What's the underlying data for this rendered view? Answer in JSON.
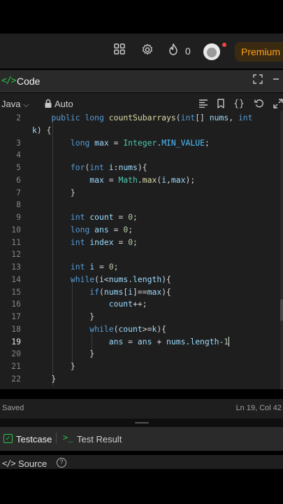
{
  "header": {
    "count": "0",
    "premium_label": "Premium"
  },
  "panel": {
    "title": "Code"
  },
  "toolbar": {
    "language": "Java",
    "mode": "Auto"
  },
  "editor": {
    "active_line": 19,
    "lines": [
      {
        "n": "2",
        "text": "    public long countSubarrays(int[] nums, int"
      },
      {
        "n": "",
        "text": "k) {"
      },
      {
        "n": "3",
        "text": "        long max = Integer.MIN_VALUE;"
      },
      {
        "n": "4",
        "text": ""
      },
      {
        "n": "5",
        "text": "        for(int i:nums){"
      },
      {
        "n": "6",
        "text": "            max = Math.max(i,max);"
      },
      {
        "n": "7",
        "text": "        }"
      },
      {
        "n": "8",
        "text": ""
      },
      {
        "n": "9",
        "text": "        int count = 0;"
      },
      {
        "n": "10",
        "text": "        long ans = 0;"
      },
      {
        "n": "11",
        "text": "        int index = 0;"
      },
      {
        "n": "12",
        "text": ""
      },
      {
        "n": "13",
        "text": "        int i = 0;"
      },
      {
        "n": "14",
        "text": "        while(i<nums.length){"
      },
      {
        "n": "15",
        "text": "            if(nums[i]==max){"
      },
      {
        "n": "16",
        "text": "                count++;"
      },
      {
        "n": "17",
        "text": "            }"
      },
      {
        "n": "18",
        "text": "            while(count>=k){"
      },
      {
        "n": "19",
        "text": "                ans = ans + nums.length-1"
      },
      {
        "n": "20",
        "text": "            }"
      },
      {
        "n": "21",
        "text": "        }"
      },
      {
        "n": "22",
        "text": "    }"
      }
    ]
  },
  "status": {
    "saved": "Saved",
    "position": "Ln 19, Col 42"
  },
  "tabs": {
    "testcase": "Testcase",
    "test_result": "Test Result"
  },
  "source": {
    "label": "Source"
  },
  "colors": {
    "accent_green": "#28c244",
    "premium_orange": "#ffa116",
    "keyword": "#569cd6"
  }
}
